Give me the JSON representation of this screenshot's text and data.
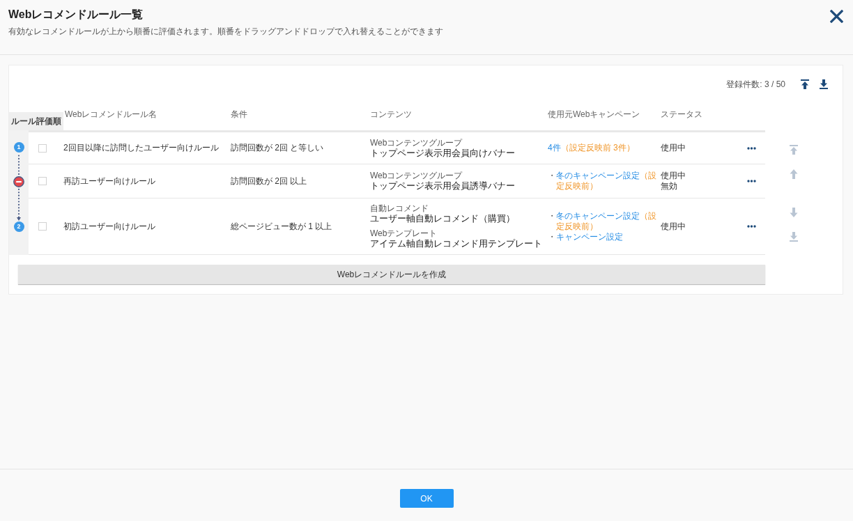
{
  "header": {
    "title": "Webレコメンドルール一覧",
    "description": "有効なレコメンドルールが上から順番に評価されます。順番をドラッグアンドドロップで入れ替えることができます"
  },
  "toolbar": {
    "count": "登録件数: 3 / 50",
    "jump_buttons": [
      {
        "kind": "top",
        "disabled": false
      },
      {
        "kind": "bottom",
        "disabled": false
      }
    ]
  },
  "table": {
    "order_label": "ルール評価順",
    "columns": [
      "Webレコメンドルール名",
      "条件",
      "コンテンツ",
      "使用元Webキャンペーン",
      "ステータス"
    ],
    "rows": [
      {
        "order": {
          "kind": "number",
          "label": "1"
        },
        "checked": false,
        "name": "2回目以降に訪問したユーザー向けルール",
        "condition": "訪問回数が 2回 と等しい",
        "contents": [
          {
            "label": "Webコンテンツグループ",
            "title": "トップページ表示用会員向けバナー"
          }
        ],
        "campaigns": {
          "kind": "summary",
          "link": "4件",
          "note": "（設定反映前 3件）"
        },
        "status": [
          "使用中"
        ]
      },
      {
        "order": {
          "kind": "excluded"
        },
        "checked": false,
        "name": "再訪ユーザー向けルール",
        "condition": "訪問回数が 2回 以上",
        "contents": [
          {
            "label": "Webコンテンツグループ",
            "title": "トップページ表示用会員誘導バナー"
          }
        ],
        "campaigns": {
          "kind": "list",
          "items": [
            {
              "marker": "・",
              "link": "冬のキャンペーン設定",
              "note": "（設定反映前）"
            }
          ]
        },
        "status": [
          "使用中",
          "無効"
        ]
      },
      {
        "order": {
          "kind": "number",
          "label": "2"
        },
        "checked": false,
        "name": "初訪ユーザー向けルール",
        "condition": "総ページビュー数が 1 以上",
        "contents": [
          {
            "label": "自動レコメンド",
            "title": "ユーザー軸自動レコメンド（購買）"
          },
          {
            "label": "Webテンプレート",
            "title": "アイテム軸自動レコメンド用テンプレート"
          }
        ],
        "campaigns": {
          "kind": "list",
          "items": [
            {
              "marker": "・",
              "link": "冬のキャンペーン設定",
              "note": "（設定反映前）"
            },
            {
              "marker": "・",
              "link": "キャンペーン設定"
            }
          ]
        },
        "status": [
          "使用中"
        ]
      }
    ]
  },
  "move_buttons": [
    {
      "kind": "top",
      "disabled": true
    },
    {
      "kind": "up",
      "disabled": true
    },
    {
      "kind": "down",
      "disabled": true
    },
    {
      "kind": "bottom",
      "disabled": true
    }
  ],
  "create_button": "Webレコメンドルールを作成",
  "footer": {
    "ok_button": "OK"
  }
}
